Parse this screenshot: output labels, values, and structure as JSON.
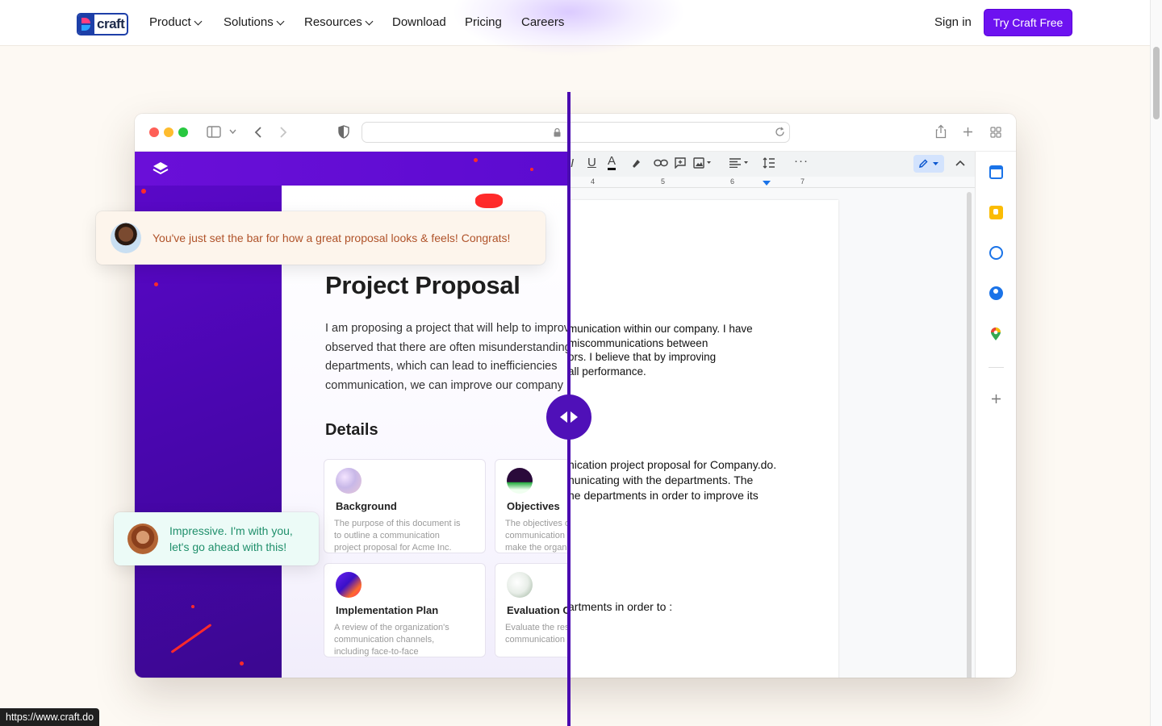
{
  "nav": {
    "logo_text": "craft",
    "items": [
      "Product",
      "Solutions",
      "Resources",
      "Download",
      "Pricing",
      "Careers"
    ],
    "sign_in": "Sign in",
    "cta": "Try Craft Free"
  },
  "craft_doc": {
    "title": "Project Proposal",
    "paragraph": "I am proposing a project that will help to improve\nobserved that there are often misunderstandings\ndepartments, which can lead to inefficiencies\ncommunication, we can improve our company",
    "details_heading": "Details",
    "cards": [
      {
        "title": "Background",
        "desc": "The purpose of this document is\nto outline a communication\nproject proposal for Acme Inc."
      },
      {
        "title": "Objectives",
        "desc": "The objectives of\ncommunication\nmake the organ..."
      },
      {
        "title": "Implementation Plan",
        "desc": "A review of the organization's\ncommunication channels,\nincluding face-to-face"
      },
      {
        "title": "Evaluation C",
        "desc": "Evaluate the res\ncommunication"
      }
    ]
  },
  "gdoc": {
    "ruler_marks": [
      "4",
      "5",
      "6",
      "7"
    ],
    "block1": "munication within our company. I have\nmiscommunications between\nors. I believe that by improving\nall performance.",
    "block2": "nication project proposal for Company.do.\nnunicating with the departments. The\nne departments in order to improve its",
    "block3": "artments in order to :"
  },
  "toasts": {
    "top": "You've just set the bar for how a great proposal looks & feels! Congrats!",
    "bottom": "Impressive. I'm with you,\nlet's go ahead with this!"
  },
  "status_url": "https://www.craft.do",
  "colors": {
    "brand_purple": "#6d12f0",
    "divider": "#4a0bb0",
    "page_bg": "#fdf9f3"
  }
}
